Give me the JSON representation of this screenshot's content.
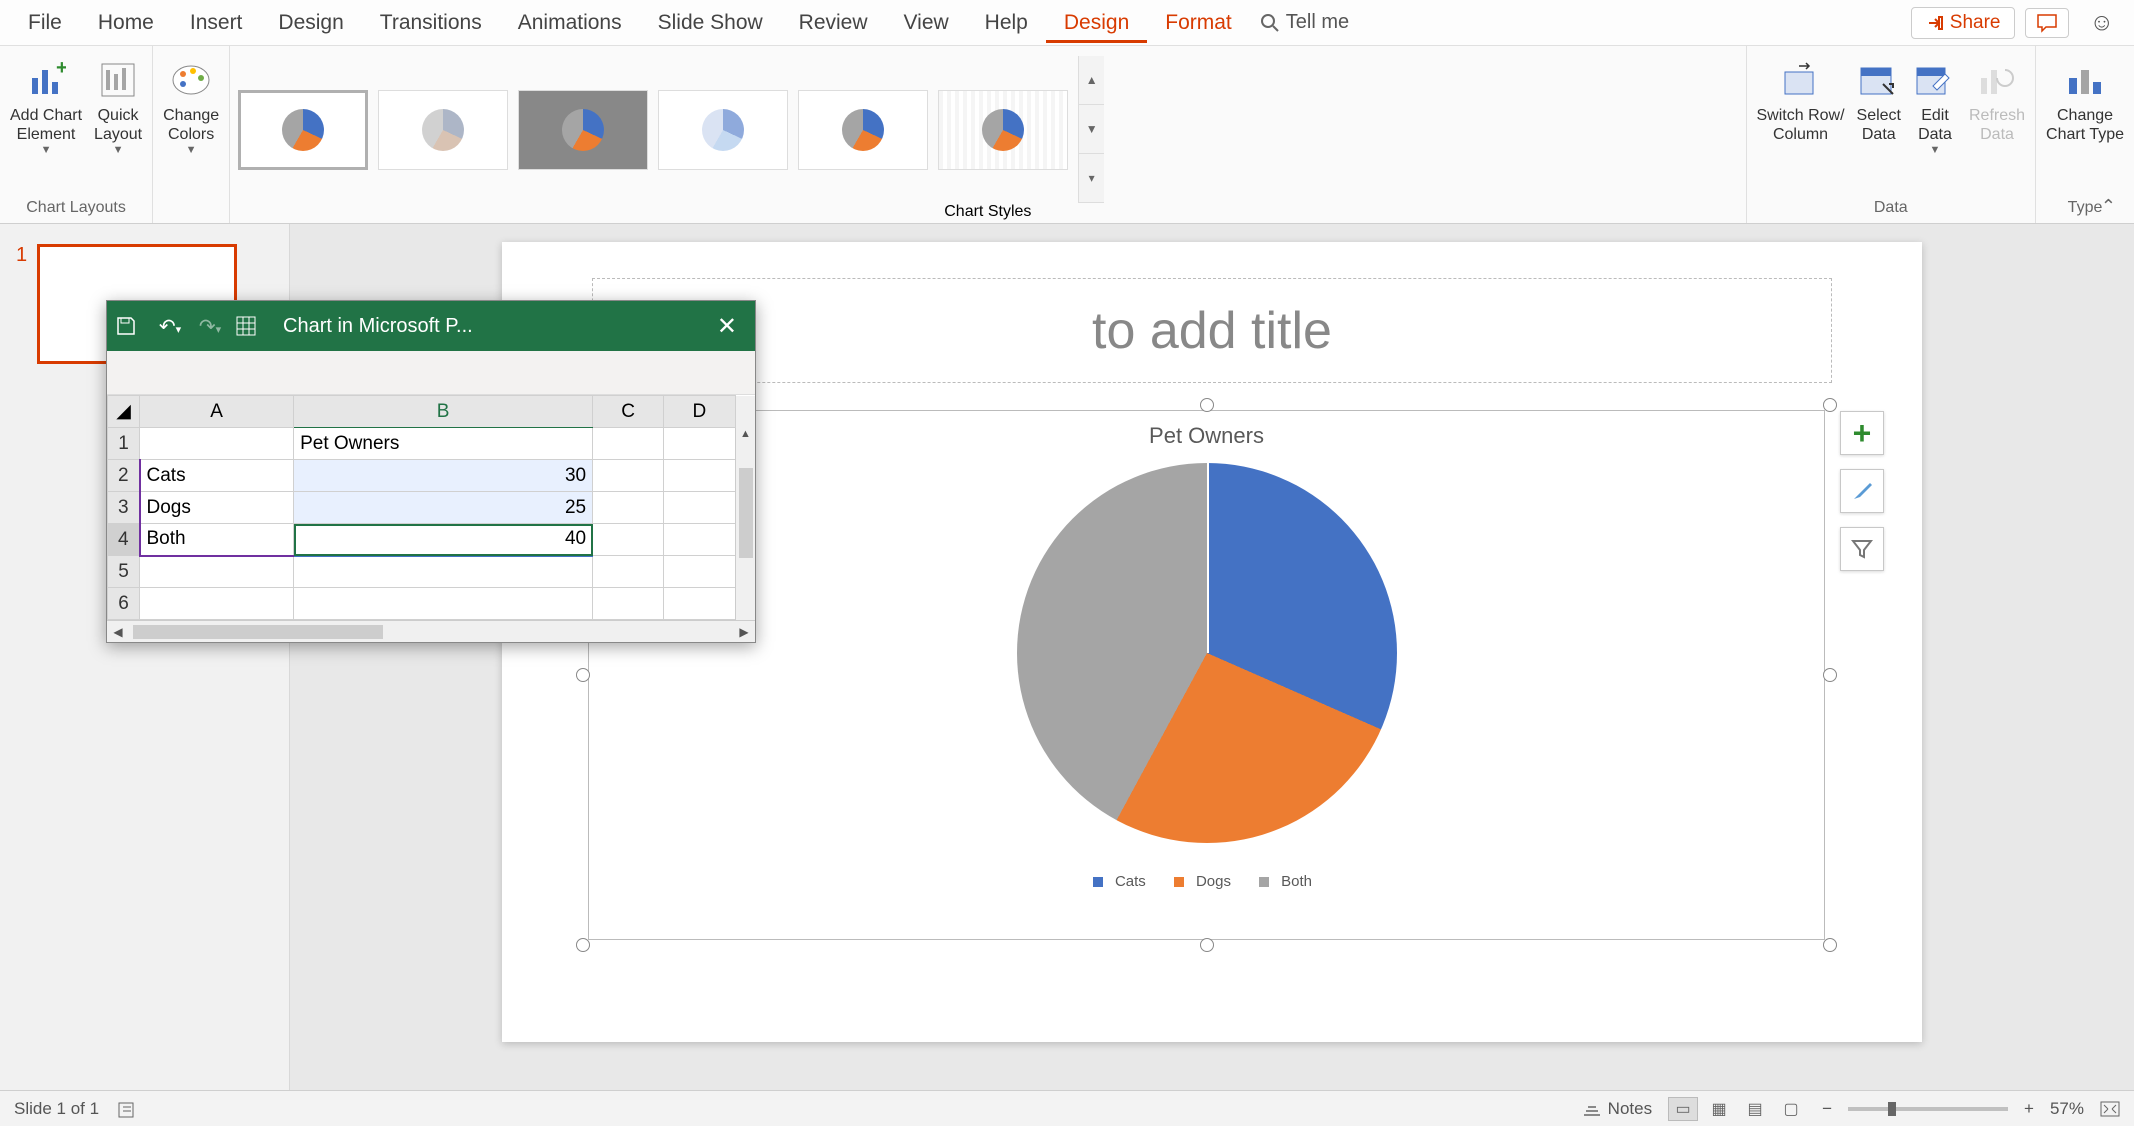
{
  "menu": {
    "items": [
      "File",
      "Home",
      "Insert",
      "Design",
      "Transitions",
      "Animations",
      "Slide Show",
      "Review",
      "View",
      "Help",
      "Design",
      "Format"
    ],
    "tellme": "Tell me",
    "share": "Share"
  },
  "ribbon": {
    "chart_layouts": {
      "label": "Chart Layouts",
      "add_chart_element": "Add Chart\nElement",
      "quick_layout": "Quick\nLayout"
    },
    "change_colors": "Change\nColors",
    "chart_styles_label": "Chart Styles",
    "data": {
      "label": "Data",
      "switch": "Switch Row/\nColumn",
      "select": "Select\nData",
      "edit": "Edit\nData",
      "refresh": "Refresh\nData"
    },
    "type": {
      "label": "Type",
      "change": "Change\nChart Type"
    }
  },
  "thumbnail": {
    "number": "1"
  },
  "slide": {
    "title_placeholder": "to add title",
    "chart_title": "Pet Owners",
    "legend": [
      "Cats",
      "Dogs",
      "Both"
    ]
  },
  "excel": {
    "title": "Chart in Microsoft P...",
    "columns": [
      "A",
      "B",
      "C",
      "D"
    ],
    "rows": [
      {
        "n": "1",
        "a": "",
        "b": "Pet Owners"
      },
      {
        "n": "2",
        "a": "Cats",
        "b": "30"
      },
      {
        "n": "3",
        "a": "Dogs",
        "b": "25"
      },
      {
        "n": "4",
        "a": "Both",
        "b": "40"
      },
      {
        "n": "5",
        "a": "",
        "b": ""
      },
      {
        "n": "6",
        "a": "",
        "b": ""
      }
    ]
  },
  "status": {
    "slide": "Slide 1 of 1",
    "notes": "Notes",
    "zoom": "57%"
  },
  "chart_data": {
    "type": "pie",
    "title": "Pet Owners",
    "categories": [
      "Cats",
      "Dogs",
      "Both"
    ],
    "values": [
      30,
      25,
      40
    ],
    "series_name": "Pet Owners",
    "colors": [
      "#4472c4",
      "#ed7d31",
      "#a5a5a5"
    ]
  }
}
